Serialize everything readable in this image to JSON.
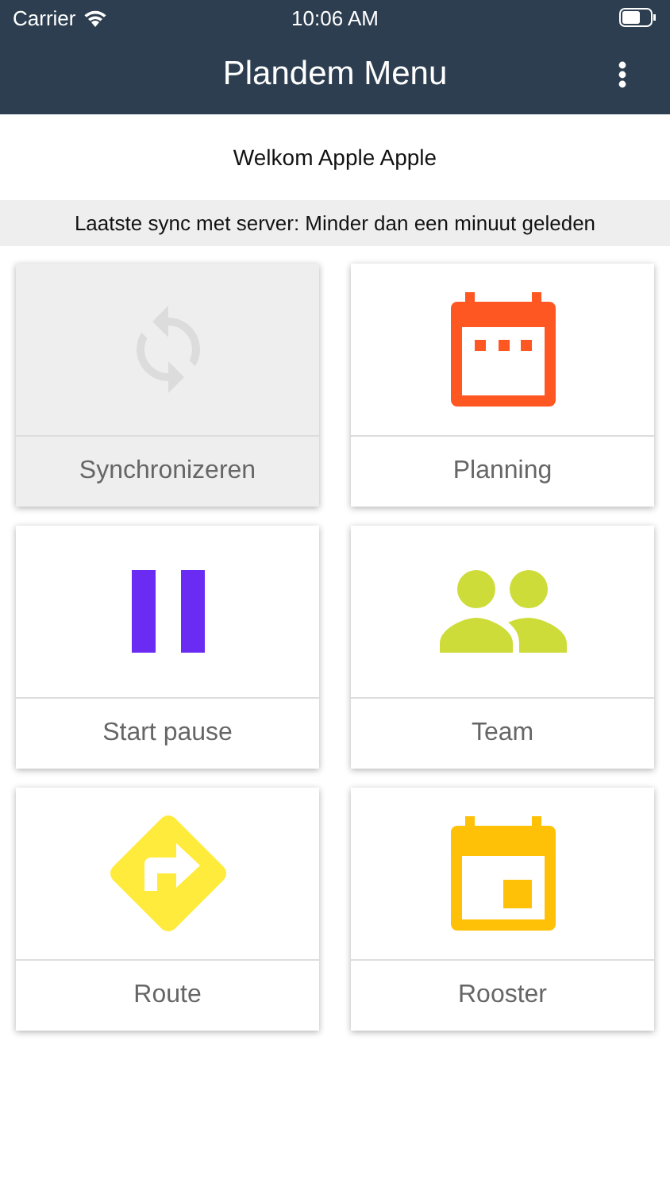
{
  "status_bar": {
    "carrier": "Carrier",
    "time": "10:06 AM"
  },
  "nav_bar": {
    "title": "Plandem Menu"
  },
  "welcome": "Welkom Apple Apple",
  "sync_status": "Laatste sync met server: Minder dan een minuut geleden",
  "tiles": [
    {
      "label": "Synchronizeren",
      "kind": "sync",
      "color": "#dcdcdc",
      "disabled": true
    },
    {
      "label": "Planning",
      "kind": "calendar-dots",
      "color": "#ff5722",
      "disabled": false
    },
    {
      "label": "Start pause",
      "kind": "pause",
      "color": "#6a2cf2",
      "disabled": false
    },
    {
      "label": "Team",
      "kind": "people",
      "color": "#cddc39",
      "disabled": false
    },
    {
      "label": "Route",
      "kind": "route",
      "color": "#ffeb3b",
      "disabled": false
    },
    {
      "label": "Rooster",
      "kind": "calendar-day",
      "color": "#ffc107",
      "disabled": false
    }
  ]
}
